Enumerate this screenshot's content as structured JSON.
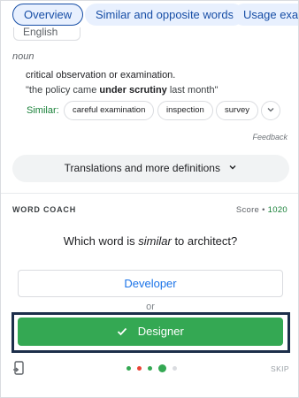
{
  "tabs": [
    {
      "label": "Overview",
      "active": true
    },
    {
      "label": "Similar and opposite words",
      "active": false
    },
    {
      "label": "Usage exam",
      "active": false
    }
  ],
  "lang_chip": "English",
  "entry": {
    "part_of_speech": "noun",
    "definition": "critical observation or examination.",
    "example_before": "\"the policy came ",
    "example_bold": "under scrutiny",
    "example_after": " last month\"",
    "similar_label": "Similar:",
    "similar_words": [
      "careful examination",
      "inspection",
      "survey"
    ],
    "more_icon": "chevron-down-icon"
  },
  "feedback_label": "Feedback",
  "translations_label": "Translations and more definitions",
  "word_coach": {
    "title": "WORD COACH",
    "score_label": "Score • ",
    "score_value": "1020",
    "question_before": "Which word is ",
    "question_italic": "similar",
    "question_after": " to architect?",
    "option_1": "Developer",
    "or_label": "or",
    "option_2": "Designer",
    "selected_icon": "check-icon",
    "skip_label": "SKIP",
    "progress_dots": [
      {
        "color": "#34a853"
      },
      {
        "color": "#ea4335"
      },
      {
        "color": "#34a853"
      },
      {
        "color": "#34a853",
        "current": true
      },
      {
        "color": "#dadce0"
      }
    ]
  },
  "colors": {
    "accent_blue": "#1a73e8",
    "tab_bg": "#e8f0fe",
    "success_green": "#34a853",
    "highlight_border": "#1c2e4a"
  }
}
